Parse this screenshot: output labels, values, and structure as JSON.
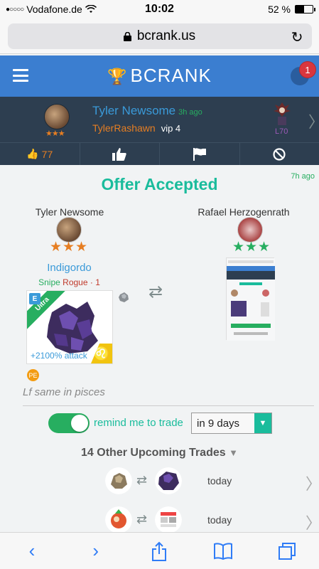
{
  "status_bar": {
    "carrier": "Vodafone.de",
    "time": "10:02",
    "battery": "52 %",
    "battery_level": 0.52
  },
  "browser": {
    "url": "bcrank.us"
  },
  "app": {
    "brand": "BCRANK",
    "notification_count": "1"
  },
  "user": {
    "name": "Tyler Newsome",
    "time_ago": "3h ago",
    "handle": "TylerRashawn",
    "vip": "vip 4",
    "level": "L70",
    "stars": "★★★"
  },
  "actions": {
    "like_count": "77"
  },
  "offer": {
    "time_ago": "7h ago",
    "title": "Offer Accepted",
    "left_party": {
      "name": "Tyler Newsome",
      "stars": "★★★",
      "monster": "Indigordo",
      "tag_1": "Snipe",
      "tag_2": "Rogue · 1",
      "ribbon": "Ultra",
      "attack": "+2100% attack",
      "badge": "PE"
    },
    "right_party": {
      "name": "Rafael Herzogenrath",
      "stars": "★★★"
    },
    "note": "Lf same in pisces"
  },
  "reminder": {
    "label": "remind me to trade",
    "selected": "in 9 days",
    "enabled": true
  },
  "upcoming": {
    "title": "14 Other Upcoming Trades",
    "trades": [
      {
        "when": "today"
      },
      {
        "when": "today"
      }
    ]
  },
  "colors": {
    "header": "#3b7ed0",
    "dark_panel": "#2d3e50",
    "accent_teal": "#1abc9c",
    "orange": "#e67e22",
    "link_blue": "#3a9ad9"
  }
}
